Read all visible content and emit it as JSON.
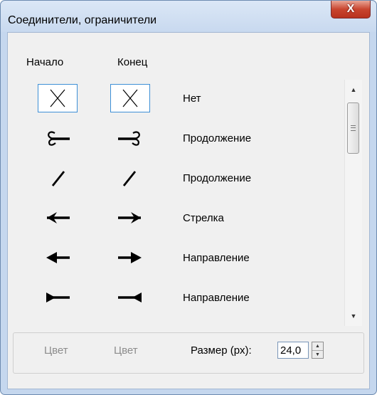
{
  "window": {
    "title": "Соединители, ограничители",
    "close_glyph": "X"
  },
  "headers": {
    "start": "Начало",
    "end": "Конец"
  },
  "rows": [
    {
      "label": "Нет",
      "start_icon": "none-x-icon",
      "end_icon": "none-x-icon"
    },
    {
      "label": "Продолжение",
      "start_icon": "continuation-hook-icon",
      "end_icon": "continuation-hook-icon"
    },
    {
      "label": "Продолжение",
      "start_icon": "continuation-slash-icon",
      "end_icon": "continuation-slash-icon"
    },
    {
      "label": "Стрелка",
      "start_icon": "open-arrow-icon",
      "end_icon": "open-arrow-icon"
    },
    {
      "label": "Направление",
      "start_icon": "solid-arrow-icon",
      "end_icon": "solid-arrow-icon"
    },
    {
      "label": "Направление",
      "start_icon": "reverse-triangle-icon",
      "end_icon": "reverse-triangle-icon"
    }
  ],
  "bottom": {
    "color_start": "Цвет",
    "color_end": "Цвет",
    "size_label": "Размер (px):",
    "size_value": "24,0"
  },
  "colors": {
    "selection_border": "#3d8fd6",
    "close_button": "#c9452f"
  }
}
